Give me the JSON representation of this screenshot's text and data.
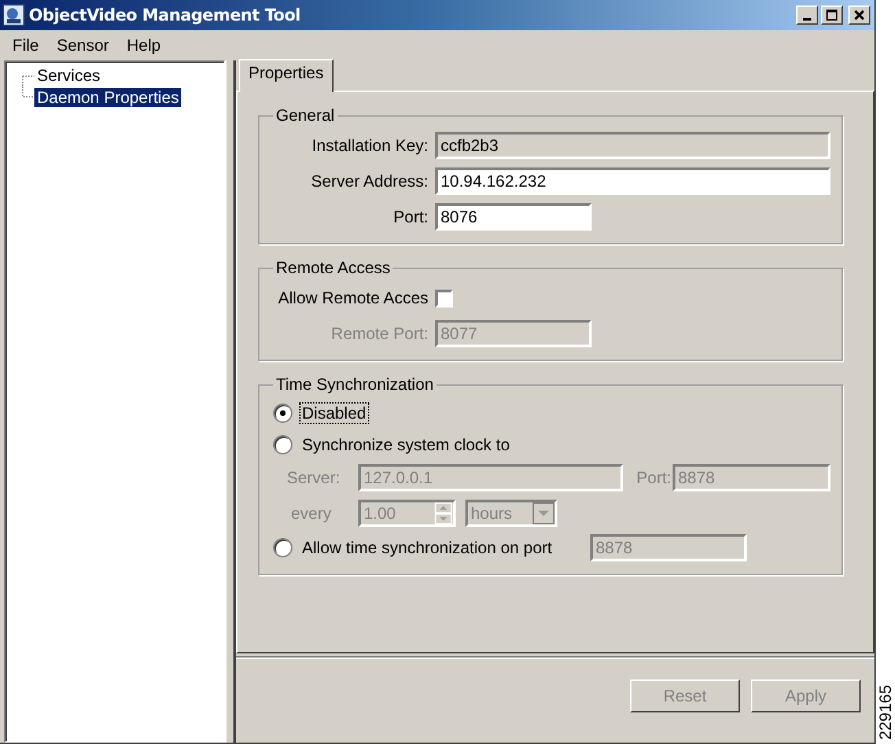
{
  "window": {
    "title": "ObjectVideo Management Tool"
  },
  "menu": [
    "File",
    "Sensor",
    "Help"
  ],
  "tree": [
    {
      "label": "Services",
      "selected": false
    },
    {
      "label": "Daemon Properties",
      "selected": true
    }
  ],
  "tabs": [
    {
      "label": "Properties",
      "selected": true
    }
  ],
  "general": {
    "title": "General",
    "fields": [
      {
        "label": "Installation Key:",
        "value": "ccfb2b3",
        "read_only": true,
        "wide": true
      },
      {
        "label": "Server Address:",
        "value": "10.94.162.232",
        "read_only": false,
        "wide": true
      },
      {
        "label": "Port:",
        "value": "8076",
        "read_only": false,
        "wide": false
      }
    ]
  },
  "remote_access": {
    "title": "Remote Access",
    "checkbox_label": "Allow Remote Acces",
    "checked": false,
    "port_label": "Remote Port:",
    "port_value": "8077",
    "port_disabled": true
  },
  "time_sync": {
    "title": "Time Synchronization",
    "options": [
      {
        "label": "Disabled",
        "selected": true,
        "focused": true
      },
      {
        "label": "Synchronize system clock to",
        "selected": false,
        "focused": false
      }
    ],
    "server_label": "Server:",
    "server_value": "127.0.0.1",
    "port_label": "Port:",
    "port_value": "8878",
    "every_label": "every",
    "every_value": "1.00",
    "unit_value": "hours",
    "fields_disabled": true,
    "allow_option": {
      "label": "Allow time synchronization on port",
      "selected": false,
      "focused": false
    },
    "allow_port_value": "8878"
  },
  "buttons": [
    {
      "label": "Reset",
      "disabled": true
    },
    {
      "label": "Apply",
      "disabled": true
    }
  ],
  "figure_number": "229165"
}
